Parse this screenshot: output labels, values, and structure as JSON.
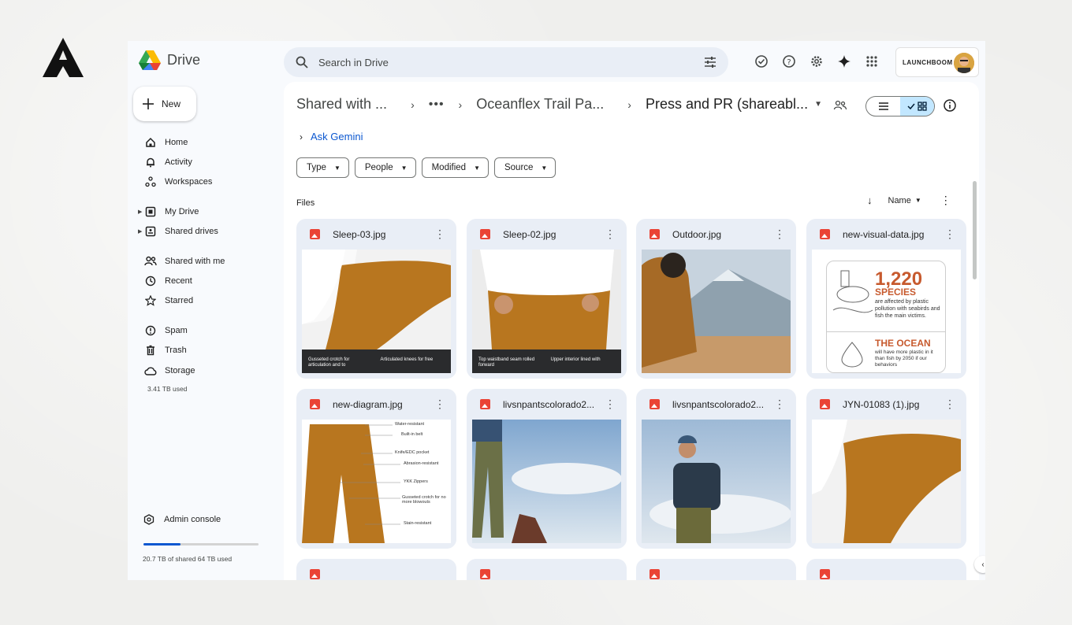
{
  "app": {
    "name": "Drive"
  },
  "search": {
    "placeholder": "Search in Drive"
  },
  "account": {
    "org_label": "LAUNCHBOOM"
  },
  "sidebar": {
    "new_label": "New",
    "items": [
      {
        "label": "Home",
        "icon": "home-icon"
      },
      {
        "label": "Activity",
        "icon": "bell-icon"
      },
      {
        "label": "Workspaces",
        "icon": "workspaces-icon"
      },
      {
        "label": "My Drive",
        "icon": "my-drive-icon"
      },
      {
        "label": "Shared drives",
        "icon": "shared-drives-icon"
      },
      {
        "label": "Shared with me",
        "icon": "people-icon"
      },
      {
        "label": "Recent",
        "icon": "clock-icon"
      },
      {
        "label": "Starred",
        "icon": "star-icon"
      },
      {
        "label": "Spam",
        "icon": "spam-icon"
      },
      {
        "label": "Trash",
        "icon": "trash-icon"
      },
      {
        "label": "Storage",
        "icon": "cloud-icon"
      }
    ],
    "storage_used": "3.41 TB used",
    "admin_label": "Admin console",
    "shared_storage_fraction": 0.32,
    "shared_storage_text": "20.7 TB of shared 64 TB used"
  },
  "breadcrumb": {
    "first": "Shared with ...",
    "more": "•••",
    "second": "Oceanflex Trail Pa...",
    "current": "Press and PR (shareabl..."
  },
  "gemini": {
    "label": "Ask Gemini"
  },
  "filters": [
    "Type",
    "People",
    "Modified",
    "Source"
  ],
  "files": {
    "label": "Files",
    "sort_label": "Name",
    "items": [
      {
        "name": "Sleep-03.jpg",
        "caption_left": "Gusseted crotch for articulation and to",
        "caption_right": "Articulated knees for free"
      },
      {
        "name": "Sleep-02.jpg",
        "caption_left": "Top waistband seam rolled forward",
        "caption_right": "Upper interior lined with"
      },
      {
        "name": "Outdoor.jpg"
      },
      {
        "name": "new-visual-data.jpg",
        "big_number": "1,220",
        "species": "SPECIES",
        "species_text": "are affected by plastic pollution with seabirds and fish the main victims.",
        "ocean": "THE OCEAN",
        "ocean_text": "will have more plastic in it than fish by 2050 if our behaviors"
      },
      {
        "name": "new-diagram.jpg",
        "labels": [
          "Water-resistant",
          "Built-in belt",
          "Knife/EDC pocket",
          "Abrasion-resistant",
          "YKK Zippers",
          "Gusseted crotch for no more blowouts",
          "Stain-resistant"
        ]
      },
      {
        "name": "livsnpantscolorado2..."
      },
      {
        "name": "livsnpantscolorado2..."
      },
      {
        "name": "JYN-01083 (1).jpg"
      }
    ]
  },
  "colors": {
    "accent": "#0b57d0",
    "chip_active": "#c2e7ff",
    "card_bg": "#e9eef6",
    "pants": "#b8761f"
  }
}
